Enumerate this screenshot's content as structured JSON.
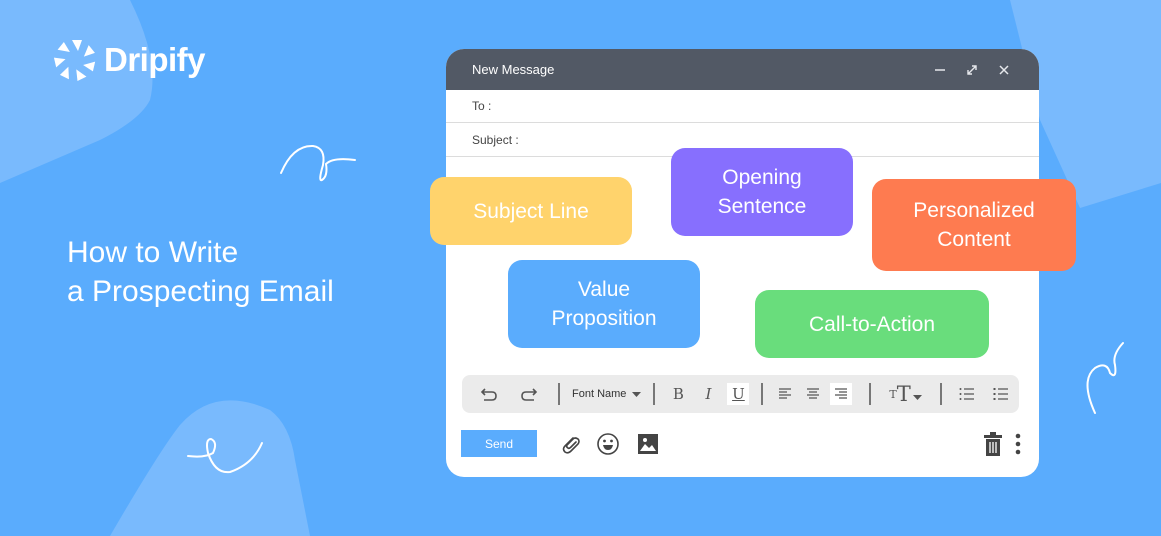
{
  "brand": {
    "name": "Dripify",
    "logo_icon": "shutter-logo-icon"
  },
  "headline": {
    "line1": "How to Write",
    "line2": "a Prospecting Email"
  },
  "colors": {
    "background": "#5aacfd",
    "background_shape": "#79bafd",
    "titlebar": "#525965",
    "chip_subject": "#ffd36c",
    "chip_opening": "#876ffe",
    "chip_personalized": "#fe7b50",
    "chip_value": "#5aacfd",
    "chip_cta": "#69dd7c",
    "send": "#5aacfd"
  },
  "compose": {
    "title": "New Message",
    "controls": {
      "minimize_icon": "minimize-icon",
      "expand_icon": "expand-icon",
      "close_icon": "close-icon"
    },
    "to_label": "To :",
    "subject_label": "Subject :"
  },
  "chips": {
    "subject_line": "Subject Line",
    "opening_l1": "Opening",
    "opening_l2": "Sentence",
    "personalized_l1": "Personalized",
    "personalized_l2": "Content",
    "value_l1": "Value",
    "value_l2": "Proposition",
    "cta": "Call-to-Action"
  },
  "toolbar": {
    "font_name": "Font Name",
    "bold": "B",
    "italic": "I",
    "underline": "U",
    "text_size": "T"
  },
  "bottom": {
    "send_label": "Send"
  }
}
